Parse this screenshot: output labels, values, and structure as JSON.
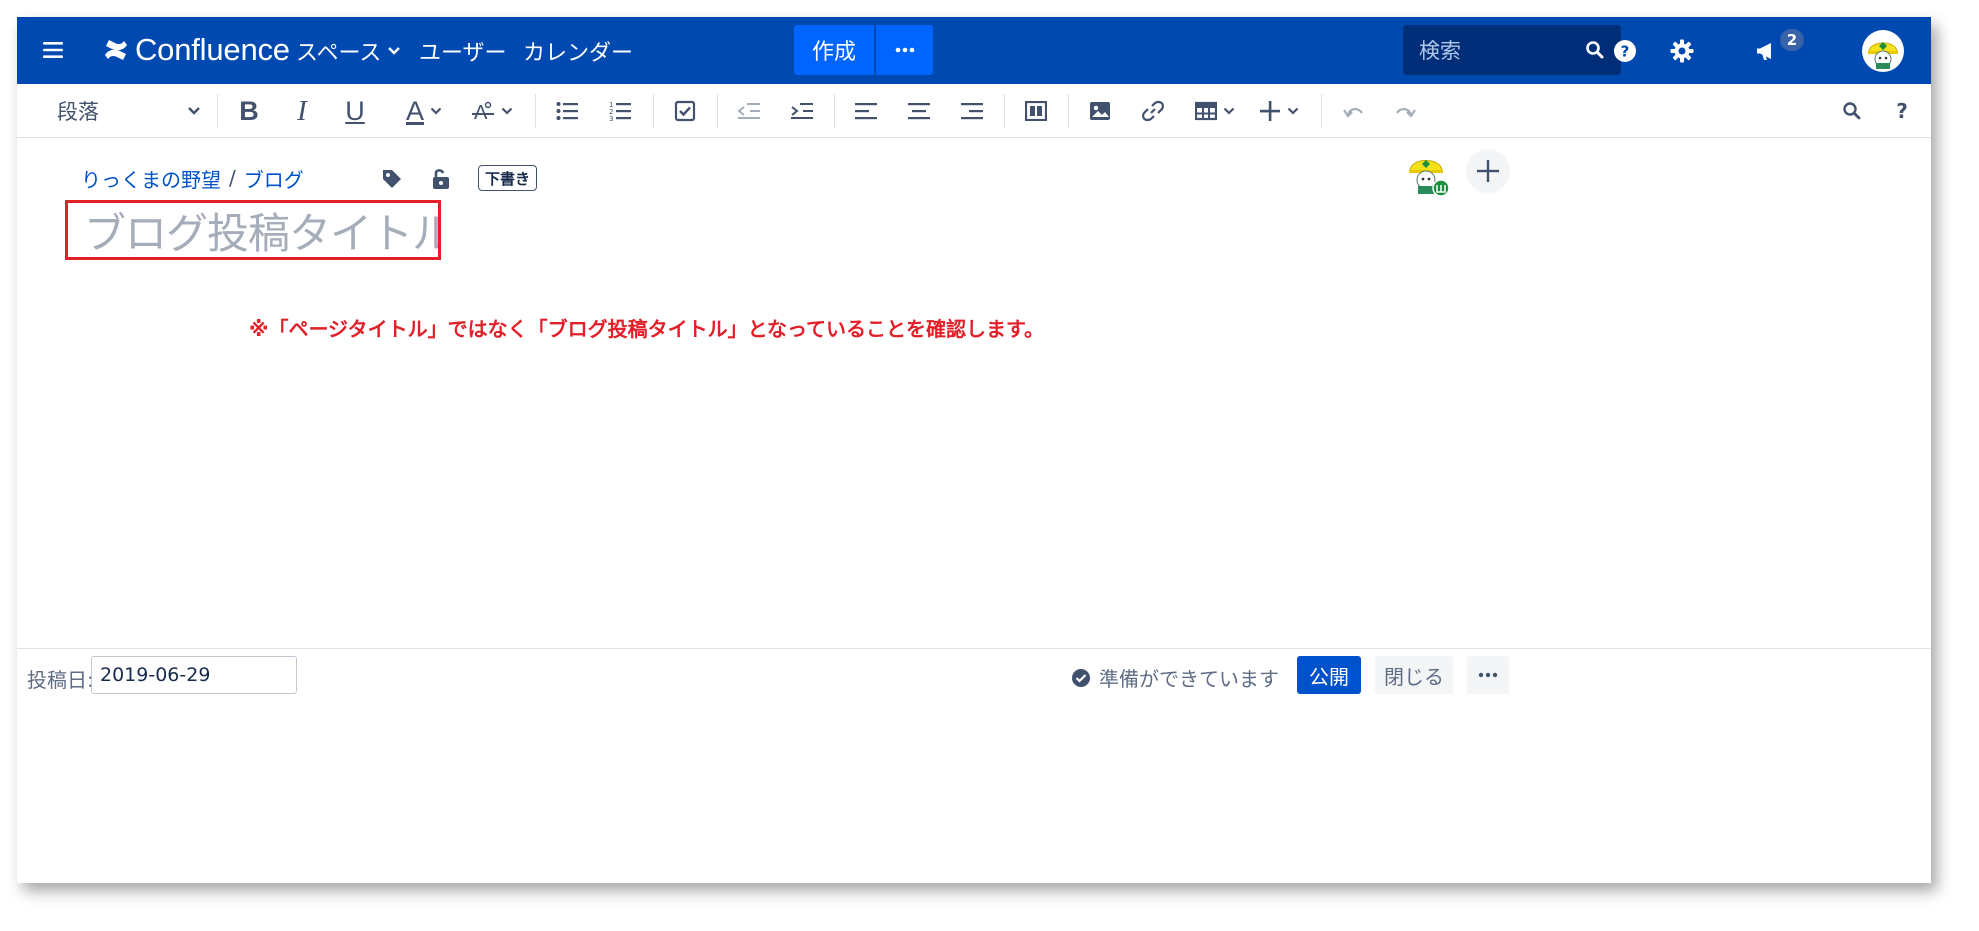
{
  "nav": {
    "logo_text": "Confluence",
    "spaces_label": "スペース",
    "users_label": "ユーザー",
    "calendar_label": "カレンダー",
    "create_label": "作成",
    "search_placeholder": "検索",
    "notification_count": "2"
  },
  "toolbar": {
    "paragraph_style": "段落",
    "bold": "B",
    "italic": "I",
    "underline": "U",
    "text_color": "A"
  },
  "breadcrumb": {
    "space": "りっくまの野望",
    "separator": "/",
    "section": "ブログ"
  },
  "draft_badge": "下書き",
  "title_placeholder": "ブログ投稿タイトル",
  "annotation": "※「ページタイトル」ではなく「ブログ投稿タイトル」となっていることを確認します。",
  "bottom": {
    "date_label": "投稿日:",
    "date_value": "2019-06-29",
    "status_text": "準備ができています",
    "publish_label": "公開",
    "close_label": "閉じる"
  },
  "colors": {
    "nav_bg": "#0049b0",
    "primary_button": "#0065ff",
    "publish_button": "#0052cc",
    "annotation_red": "#e2202a"
  }
}
